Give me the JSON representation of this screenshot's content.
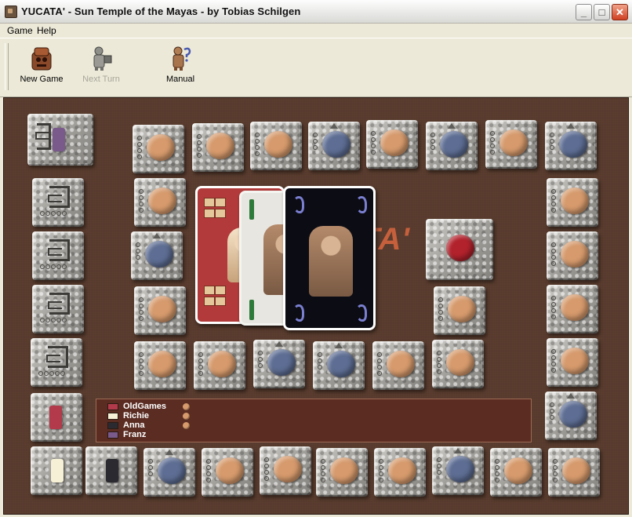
{
  "window": {
    "title": "YUCATA' - Sun Temple of the Mayas - by Tobias Schilgen"
  },
  "menu": [
    "Game",
    "Help"
  ],
  "toolbar": [
    {
      "label": "New Game",
      "icon": "temple-icon",
      "enabled": true
    },
    {
      "label": "Next Turn",
      "icon": "maya-figure-icon",
      "enabled": false
    },
    {
      "label": "Manual",
      "icon": "maya-figure-question-icon",
      "enabled": true
    }
  ],
  "board": {
    "logo_text": "TA'",
    "colors": {
      "background": "#5a3d2f",
      "orange_token": "#d69a6c",
      "blue_token": "#5d6d93",
      "red_token": "#b2222c"
    },
    "tokens": {
      "top_row": [
        "orange",
        "orange",
        "orange",
        "blue",
        "orange",
        "blue",
        "orange",
        "blue"
      ],
      "bottom_row": [
        "blue",
        "orange",
        "orange",
        "orange",
        "orange",
        "blue",
        "orange",
        "orange"
      ]
    },
    "cards": [
      "red",
      "white",
      "black"
    ],
    "players": [
      {
        "name": "OldGames",
        "color": "#b23a4a",
        "has_token": true
      },
      {
        "name": "Richie",
        "color": "#f6f1d6",
        "has_token": true
      },
      {
        "name": "Anna",
        "color": "#2a2a30",
        "has_token": true
      },
      {
        "name": "Franz",
        "color": "#7a5a8a",
        "has_token": false
      }
    ]
  }
}
